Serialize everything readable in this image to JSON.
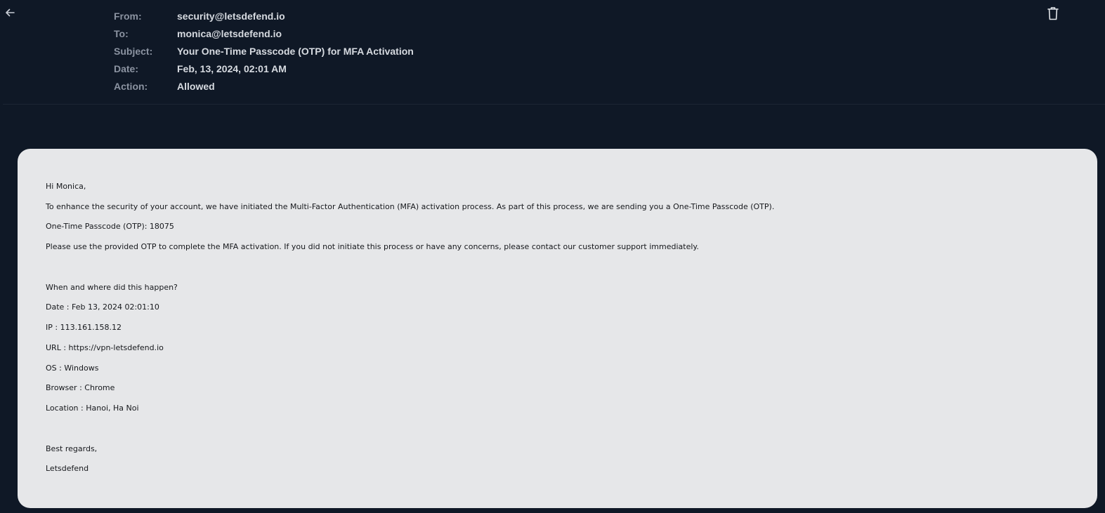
{
  "header": {
    "back_icon": "arrow-left-icon",
    "delete_icon": "trash-icon",
    "fields": [
      {
        "label": "From:",
        "value": "security@letsdefend.io"
      },
      {
        "label": "To:",
        "value": "monica@letsdefend.io"
      },
      {
        "label": "Subject:",
        "value": "Your One-Time Passcode (OTP) for MFA Activation"
      },
      {
        "label": "Date:",
        "value": "Feb, 13, 2024, 02:01 AM"
      },
      {
        "label": "Action:",
        "value": "Allowed"
      }
    ]
  },
  "body": {
    "greeting": "Hi Monica,",
    "intro": "To enhance the security of your account, we have initiated the Multi-Factor Authentication (MFA) activation process. As part of this process, we are sending you a One-Time Passcode (OTP).",
    "otp": "One-Time Passcode (OTP): 18075",
    "instruction": "Please use the provided OTP to complete the MFA activation. If you did not initiate this process or have any concerns, please contact our customer support immediately.",
    "details_heading": "When and where did this happen?",
    "details": [
      "Date : Feb 13, 2024 02:01:10",
      "IP : 113.161.158.12",
      "URL : https://vpn-letsdefend.io",
      "OS : Windows",
      "Browser : Chrome",
      "Location : Hanoi, Ha Noi"
    ],
    "closing": "Best regards,",
    "signature": "Letsdefend"
  },
  "colors": {
    "background": "#0f1826",
    "label": "#8b93a1",
    "value": "#d6dae0",
    "body_bg": "#e6e7e9"
  }
}
